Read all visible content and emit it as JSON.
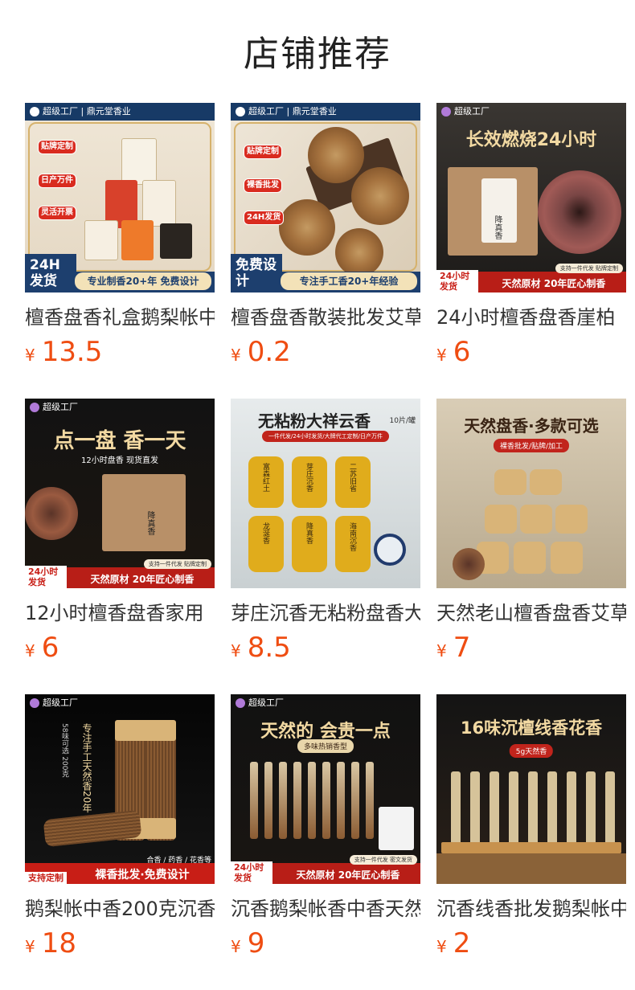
{
  "page_title": "店铺推荐",
  "currency": "¥",
  "products": [
    {
      "name": "檀香盘香礼盒鹅梨帐中香家用",
      "price": "13.5",
      "img": {
        "brand": "超级工厂 | 鼎元堂香业",
        "tags": [
          "贴牌定制",
          "日产万件",
          "灵活开票"
        ],
        "corner": "24H发货",
        "banner": "专业制香20+年  免费设计"
      }
    },
    {
      "name": "檀香盘香散装批发艾草",
      "price": "0.2",
      "img": {
        "brand": "超级工厂 | 鼎元堂香业",
        "tags": [
          "贴牌定制",
          "裸香批发",
          "24H发货"
        ],
        "corner": "免费设计",
        "banner": "专注手工香20+年经验"
      }
    },
    {
      "name": "24小时檀香盘香崖柏",
      "price": "6",
      "img": {
        "brand": "超级工厂",
        "headline": "长效燃烧24小时",
        "box_label": "降真香",
        "corner": "24小时发货",
        "banner_top": "支持一件代发 贴牌定制",
        "banner": "天然原材 20年匠心制香"
      }
    },
    {
      "name": "12小时檀香盘香家用",
      "price": "6",
      "img": {
        "brand": "超级工厂",
        "headline": "点一盘 香一天",
        "subline": "12小时盘香 现货直发",
        "box_label": "降真香",
        "corner": "24小时发货",
        "banner_top": "支持一件代发 贴牌定制",
        "banner": "天然原材 20年匠心制香"
      }
    },
    {
      "name": "芽庄沉香无粘粉盘香大祥云",
      "price": "8.5",
      "img": {
        "headline": "无粘粉大祥云香",
        "unit": "10片/罐",
        "pill": "一件代发/24小时发货/大牌代工定制/日产万件",
        "jars": [
          "富森红土",
          "芽庄沉香",
          "二苏旧省",
          "龙涎香",
          "降真香",
          "海南沉香"
        ]
      }
    },
    {
      "name": "天然老山檀香盘香艾草",
      "price": "7",
      "img": {
        "headline": "天然盘香·多款可选",
        "pill": "裸香批发/贴牌/加工"
      }
    },
    {
      "name": "鹅梨帐中香200克沉香",
      "price": "18",
      "img": {
        "brand": "超级工厂",
        "vertical": "专注手工天然香20年",
        "side": "58味可选  200克",
        "corner": "支持定制",
        "banner_top": "合香 / 药香 / 花香等",
        "banner": "裸香批发·免费设计"
      }
    },
    {
      "name": "沉香鹅梨帐香中香天然",
      "price": "9",
      "img": {
        "brand": "超级工厂",
        "headline": "天然的 会贵一点",
        "pill": "多味热销香型",
        "corner": "24小时发货",
        "banner_top": "支持一件代发 密文发货",
        "banner": "天然原材 20年匠心制香"
      }
    },
    {
      "name": "沉香线香批发鹅梨帐中香",
      "price": "2",
      "img": {
        "headline": "16味沉檀线香花香",
        "pill": "5g天然香"
      }
    }
  ]
}
